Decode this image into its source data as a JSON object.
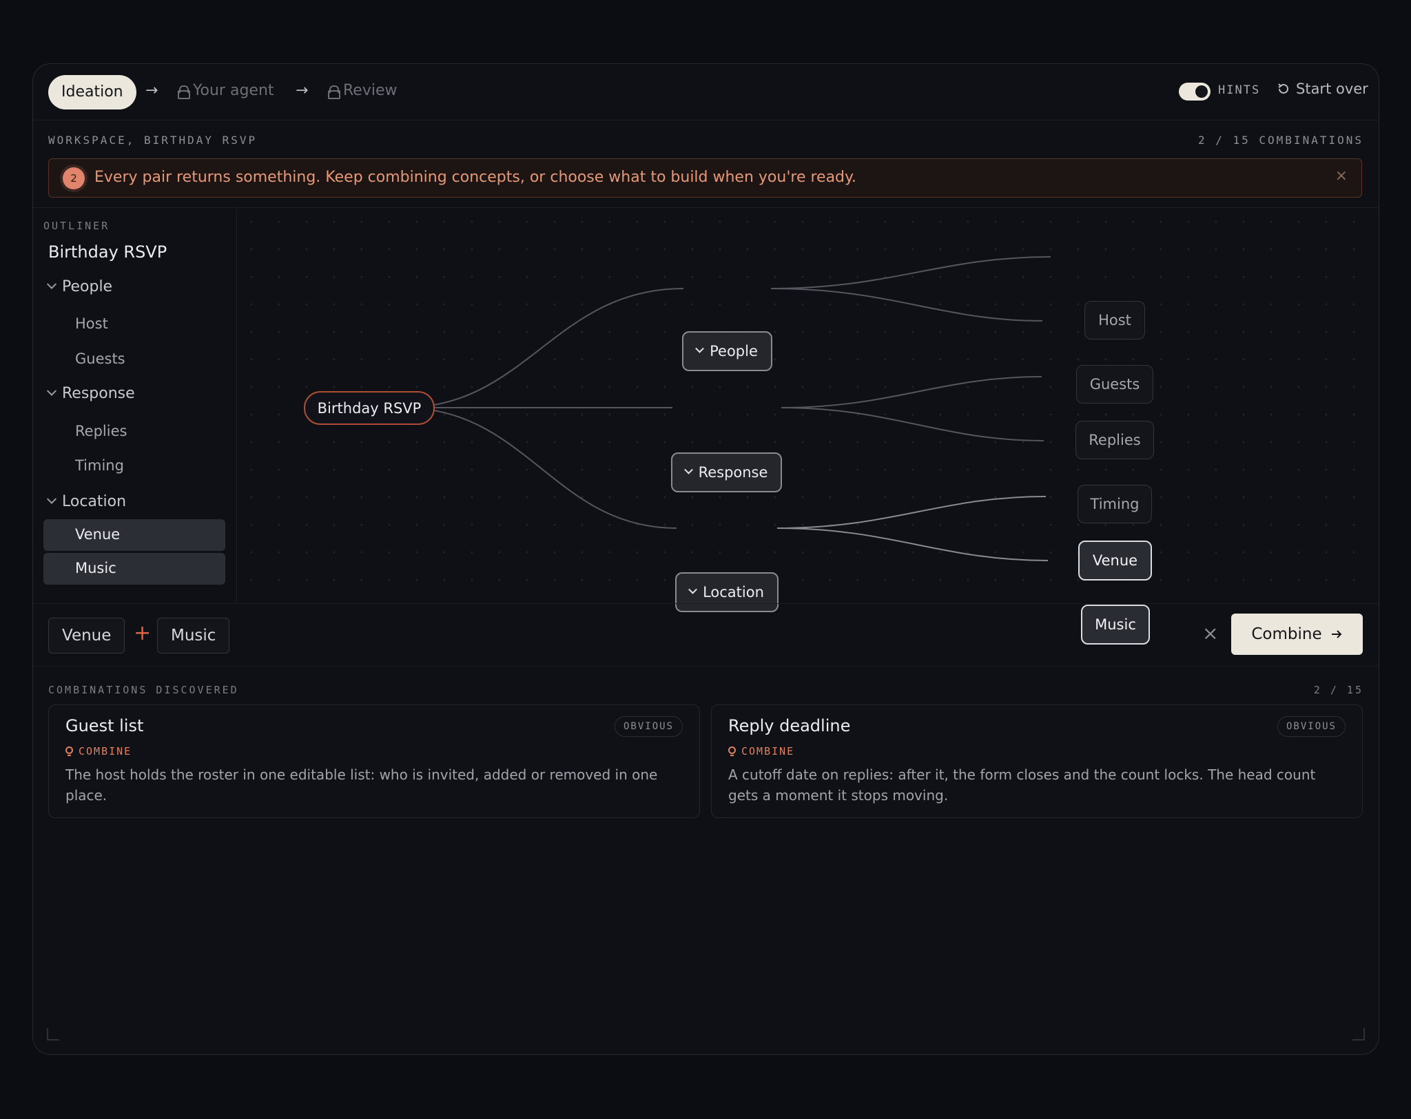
{
  "steps": {
    "active": "Ideation",
    "arrow": "→",
    "agent": "Your agent",
    "review": "Review"
  },
  "topbar": {
    "hints_label": "HINTS",
    "hints_on": true,
    "start_over": "Start over"
  },
  "workspace": {
    "label": "WORKSPACE, BIRTHDAY RSVP",
    "count": "2 / 15 COMBINATIONS"
  },
  "banner": {
    "badge": "2",
    "text": "Every pair returns something. Keep combining concepts, or choose what to build when you're ready.",
    "close": "×"
  },
  "outliner": {
    "label": "OUTLINER",
    "root": "Birthday RSVP",
    "groups": [
      {
        "label": "People",
        "items": [
          "Host",
          "Guests"
        ]
      },
      {
        "label": "Response",
        "items": [
          "Replies",
          "Timing"
        ]
      },
      {
        "label": "Location",
        "items": [
          "Venue",
          "Music"
        ]
      }
    ]
  },
  "graph": {
    "root": "Birthday RSVP",
    "people": "People",
    "response": "Response",
    "location": "Location",
    "host": "Host",
    "guests": "Guests",
    "replies": "Replies",
    "timing": "Timing",
    "venue": "Venue",
    "music": "Music"
  },
  "combine": {
    "chip_a": "Venue",
    "plus": "+",
    "chip_b": "Music",
    "clear": "×",
    "button": "Combine"
  },
  "combinations": {
    "label": "COMBINATIONS DISCOVERED",
    "count": "2 / 15",
    "cards": [
      {
        "title": "Guest list",
        "tag": "OBVIOUS",
        "kind": "COMBINE",
        "desc": "The host holds the roster in one editable list: who is invited, added or removed in one place."
      },
      {
        "title": "Reply deadline",
        "tag": "OBVIOUS",
        "kind": "COMBINE",
        "desc": "A cutoff date on replies: after it, the form closes and the count locks. The head count gets a moment it stops moving."
      }
    ]
  },
  "colors": {
    "accent": "#e0805f",
    "root_border": "#b04d35",
    "cta_bg": "#ece7dd"
  }
}
